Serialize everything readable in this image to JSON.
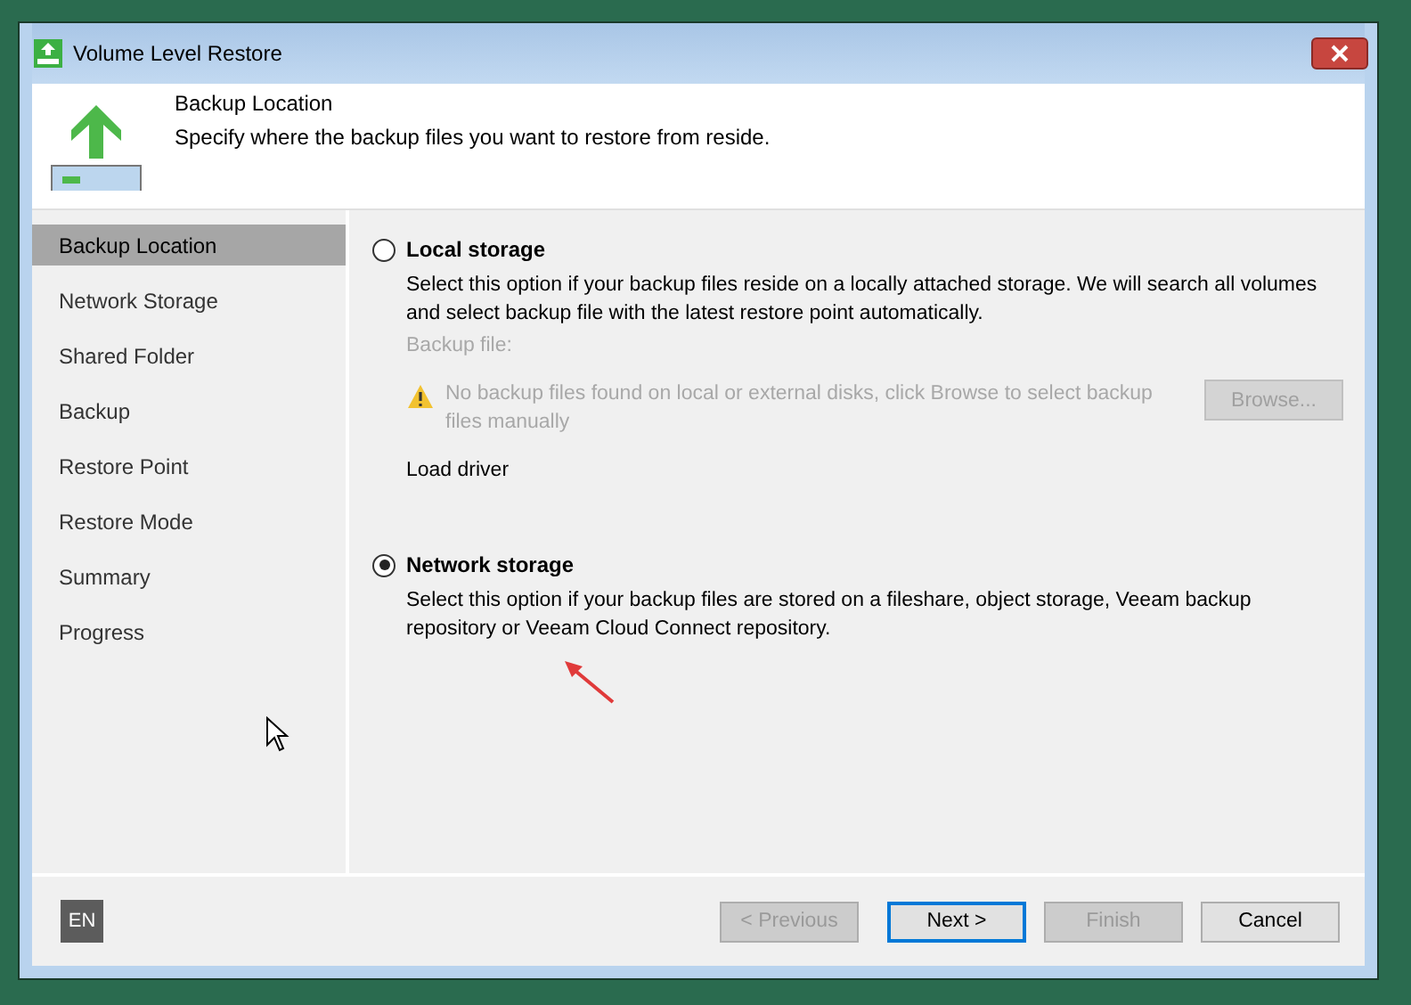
{
  "window": {
    "title": "Volume Level Restore"
  },
  "header": {
    "title": "Backup Location",
    "subtitle": "Specify where the backup files you want to restore from reside."
  },
  "sidebar": {
    "items": [
      {
        "label": "Backup Location",
        "selected": true
      },
      {
        "label": "Network Storage",
        "selected": false
      },
      {
        "label": "Shared Folder",
        "selected": false
      },
      {
        "label": "Backup",
        "selected": false
      },
      {
        "label": "Restore Point",
        "selected": false
      },
      {
        "label": "Restore Mode",
        "selected": false
      },
      {
        "label": "Summary",
        "selected": false
      },
      {
        "label": "Progress",
        "selected": false
      }
    ]
  },
  "options": [
    {
      "label": "Local storage",
      "selected": false,
      "description": "Select this option if your backup files reside on a locally attached storage. We will search all volumes and select backup file with the latest restore point automatically.",
      "details": {
        "field_label": "Backup file:",
        "warning": "No backup files found on local or external disks, click Browse to select backup files manually",
        "browse": "Browse...",
        "disabled": true,
        "link": "Load driver"
      }
    },
    {
      "label": "Network storage",
      "selected": true,
      "description": "Select this option if your backup files are stored on a fileshare, object storage, Veeam backup repository or Veeam Cloud Connect repository."
    }
  ],
  "footer": {
    "language": "EN",
    "buttons": [
      {
        "label": "< Previous",
        "disabled": true,
        "default": false
      },
      {
        "label": "Next >",
        "disabled": false,
        "default": true
      },
      {
        "label": "Finish",
        "disabled": true,
        "default": false
      },
      {
        "label": "Cancel",
        "disabled": false,
        "default": false
      }
    ]
  }
}
